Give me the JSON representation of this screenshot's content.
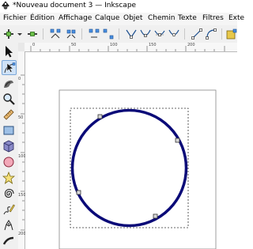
{
  "window": {
    "title": "*Nouveau document 3 — Inkscape"
  },
  "menu": [
    {
      "label": "Fichier"
    },
    {
      "label": "Édition"
    },
    {
      "label": "Affichage"
    },
    {
      "label": "Calque"
    },
    {
      "label": "Objet"
    },
    {
      "label": "Chemin"
    },
    {
      "label": "Texte"
    },
    {
      "label": "Filtres"
    },
    {
      "label": "Exte"
    }
  ],
  "ruler": {
    "h_ticks": [
      "0",
      "50",
      "100",
      "150",
      "200"
    ],
    "v_ticks": [
      "0",
      "50",
      "100",
      "150",
      "200"
    ]
  },
  "tools": [
    {
      "icon": "selector-arrow-icon"
    },
    {
      "icon": "node-editor-icon",
      "active": true
    },
    {
      "icon": "tweak-icon"
    },
    {
      "icon": "zoom-icon"
    },
    {
      "icon": "measure-icon"
    },
    {
      "icon": "rectangle-icon"
    },
    {
      "icon": "3d-box-icon"
    },
    {
      "icon": "ellipse-icon"
    },
    {
      "icon": "star-icon"
    },
    {
      "icon": "spiral-icon"
    },
    {
      "icon": "pencil-icon"
    },
    {
      "icon": "pen-icon"
    }
  ],
  "colors": {
    "circle_stroke": "#0a0a78",
    "active_tool": "#cfe2f7"
  }
}
